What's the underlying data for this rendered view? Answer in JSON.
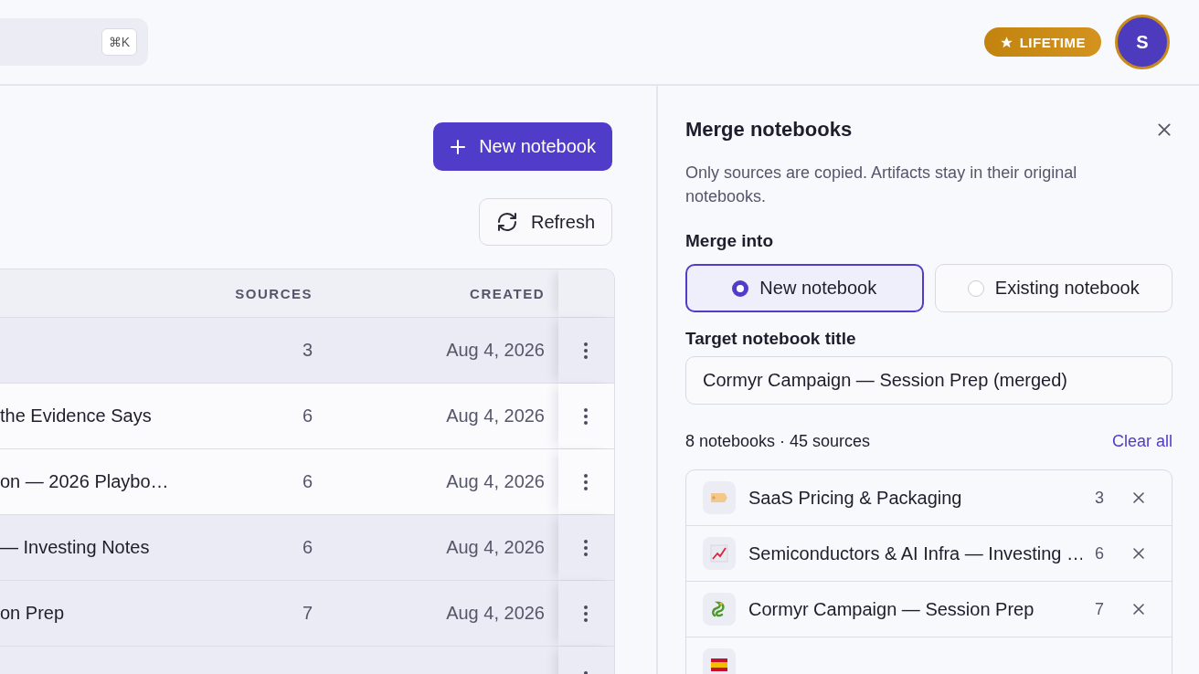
{
  "search": {
    "shortcut": "⌘K"
  },
  "badge": {
    "label": "LIFETIME"
  },
  "avatar": {
    "initial": "S"
  },
  "actions": {
    "new_notebook": "New notebook",
    "refresh": "Refresh"
  },
  "table": {
    "columns": [
      "SOURCES",
      "CREATED"
    ],
    "rows": [
      {
        "sources": "3",
        "created": "Aug 4, 2026",
        "selected": true
      },
      {
        "name": "the Evidence Says",
        "sources": "6",
        "created": "Aug 4, 2026",
        "selected": false
      },
      {
        "name": "on — 2026 Playbo…",
        "sources": "6",
        "created": "Aug 4, 2026",
        "selected": false
      },
      {
        "name": "— Investing Notes",
        "sources": "6",
        "created": "Aug 4, 2026",
        "selected": true
      },
      {
        "name": "on Prep",
        "sources": "7",
        "created": "Aug 4, 2026",
        "selected": true
      },
      {
        "selected": true
      }
    ]
  },
  "merge_panel": {
    "title": "Merge notebooks",
    "description": "Only sources are copied. Artifacts stay in their original notebooks.",
    "merge_into_label": "Merge into",
    "options": [
      {
        "label": "New notebook",
        "selected": true
      },
      {
        "label": "Existing notebook",
        "selected": false
      }
    ],
    "target_label": "Target notebook title",
    "target_value": "Cormyr Campaign — Session Prep (merged)",
    "summary": "8 notebooks · 45 sources",
    "clear_all": "Clear all",
    "notebooks": [
      {
        "kind": "full",
        "title": "SaaS Pricing & Packaging",
        "count": "3"
      },
      {
        "kind": "full",
        "title": "Semiconductors & AI Infra — Investing …",
        "count": "6"
      },
      {
        "kind": "full",
        "title": "Cormyr Campaign — Session Prep",
        "count": "7"
      },
      {
        "kind": "cut"
      }
    ]
  }
}
